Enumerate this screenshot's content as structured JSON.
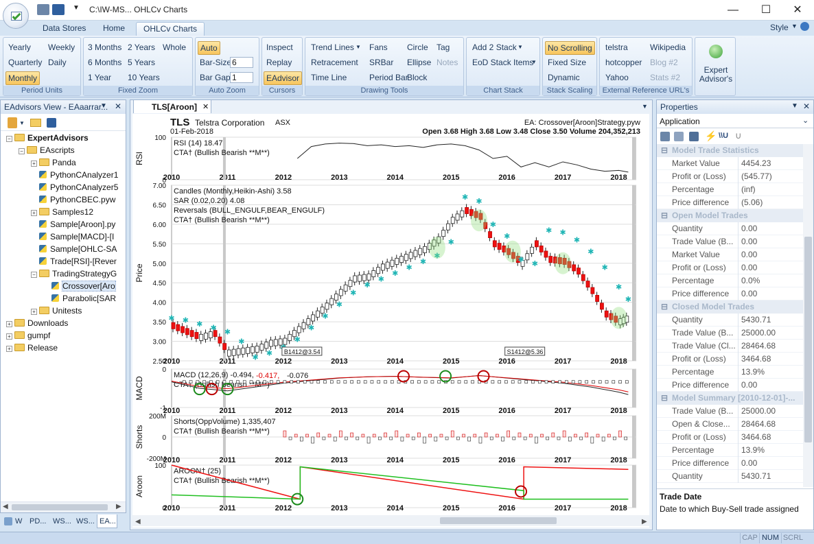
{
  "window": {
    "title": "C:\\IW-MS...     OHLCv Charts",
    "minimize": "—",
    "maximize": "☐",
    "close": "✕"
  },
  "tabs": [
    "Data Stores",
    "Home",
    "OHLCv Charts"
  ],
  "style_menu": "Style",
  "ribbon": {
    "period_units": {
      "label": "Period Units",
      "items": [
        "Yearly",
        "Weekly",
        "Quarterly",
        "Daily",
        "Monthly"
      ]
    },
    "fixed_zoom": {
      "label": "Fixed Zoom",
      "items": [
        "3 Months",
        "2 Years",
        "Whole",
        "6 Months",
        "5 Years",
        "1 Year",
        "10 Years"
      ]
    },
    "auto_zoom": {
      "label": "Auto Zoom",
      "auto": "Auto",
      "bar_size_label": "Bar-Size",
      "bar_size": "6",
      "bar_gap_label": "Bar Gap",
      "bar_gap": "1"
    },
    "cursors": {
      "label": "Cursors",
      "items": [
        "Inspect",
        "Replay",
        "EAdvisor"
      ]
    },
    "drawing_tools": {
      "label": "Drawing Tools",
      "items": [
        "Trend Lines",
        "Fans",
        "Circle",
        "Tag",
        "Retracement",
        "SRBar",
        "Ellipse",
        "Notes",
        "Time Line",
        "Period Bar",
        "Block"
      ]
    },
    "chart_stack": {
      "label": "Chart Stack",
      "items": [
        "Add 2 Stack",
        "EoD Stack Items"
      ]
    },
    "stack_scaling": {
      "label": "Stack Scaling",
      "items": [
        "No Scrolling",
        "Fixed Size",
        "Dynamic"
      ]
    },
    "external_refs": {
      "label": "External Reference URL's",
      "items": [
        "telstra",
        "Wikipedia",
        "hotcopper",
        "Blog #2",
        "Yahoo",
        "Stats #2"
      ]
    },
    "expert_advisors": {
      "label": "Expert Advisor's"
    }
  },
  "left_panel": {
    "title": "EAdvisors View - EAaarrar...",
    "tree": [
      {
        "label": "ExpertAdvisors",
        "level": 0,
        "type": "folder",
        "bold": true,
        "expander": "−"
      },
      {
        "label": "EAscripts",
        "level": 1,
        "type": "folder",
        "expander": "−"
      },
      {
        "label": "Panda",
        "level": 2,
        "type": "folder",
        "expander": "+"
      },
      {
        "label": "PythonCAnalyzer1",
        "level": 2,
        "type": "py"
      },
      {
        "label": "PythonCAnalyzer5",
        "level": 2,
        "type": "py"
      },
      {
        "label": "PythonCBEC.pyw",
        "level": 2,
        "type": "py"
      },
      {
        "label": "Samples12",
        "level": 2,
        "type": "folder",
        "expander": "+"
      },
      {
        "label": "Sample[Aroon].py",
        "level": 2,
        "type": "py"
      },
      {
        "label": "Sample[MACD]-[I",
        "level": 2,
        "type": "py"
      },
      {
        "label": "Sample[OHLC-SA",
        "level": 2,
        "type": "py"
      },
      {
        "label": "Trade[RSI]-[Rever",
        "level": 2,
        "type": "py"
      },
      {
        "label": "TradingStrategyG",
        "level": 2,
        "type": "folder",
        "expander": "−"
      },
      {
        "label": "Crossover[Aro",
        "level": 3,
        "type": "py",
        "selected": true
      },
      {
        "label": "Parabolic[SAR",
        "level": 3,
        "type": "py"
      },
      {
        "label": "Unitests",
        "level": 2,
        "type": "folder",
        "expander": "+"
      },
      {
        "label": "Downloads",
        "level": 0,
        "type": "folder",
        "expander": "+"
      },
      {
        "label": "gumpf",
        "level": 0,
        "type": "folder",
        "expander": "+"
      },
      {
        "label": "Release",
        "level": 0,
        "type": "folder",
        "expander": "+"
      }
    ],
    "bottom_tabs": [
      "W",
      "PD...",
      "WS...",
      "WS...",
      "EA..."
    ]
  },
  "document_tab": "TLS[Aroon]",
  "chart_header": {
    "ticker": "TLS",
    "company": "Telstra Corporation",
    "exchange": "ASX",
    "date": "01-Feb-2018",
    "ea": "EA: Crossover[Aroon]Strategy.pyw",
    "ohlcv": "Open 3.68  High 3.68  Low 3.48  Close 3.50  Volume 204,352,213"
  },
  "chart_data": [
    {
      "type": "line",
      "name": "RSI",
      "ylabel": "RSI",
      "legend": [
        "RSI (14)  18.47",
        "CTA† (Bullish Bearish  **M**)"
      ],
      "yticks": [
        "100",
        "0"
      ],
      "ylim": [
        0,
        100
      ],
      "x": [
        2010.0,
        2010.25,
        2010.5,
        2010.75,
        2011.0,
        2011.25,
        2011.5,
        2011.75,
        2012.0,
        2012.25,
        2012.5,
        2012.75,
        2013.0,
        2013.25,
        2013.5,
        2013.75,
        2014.0,
        2014.25,
        2014.5,
        2014.75,
        2015.0,
        2015.25,
        2015.5,
        2015.75,
        2016.0,
        2016.25,
        2016.5,
        2016.75,
        2017.0,
        2017.25,
        2017.5,
        2017.75,
        2018.0,
        2018.17
      ],
      "values": [
        null,
        null,
        null,
        null,
        null,
        null,
        null,
        null,
        null,
        50,
        78,
        84,
        86,
        85,
        80,
        82,
        78,
        80,
        76,
        82,
        84,
        80,
        70,
        50,
        55,
        30,
        40,
        30,
        42,
        35,
        25,
        20,
        22,
        18
      ]
    },
    {
      "type": "candlestick",
      "name": "Price",
      "ylabel": "Price",
      "legend": [
        "Candles (Monthly,Heikin-Ashi)  3.58",
        "SAR (0.02,0.20)  4.08",
        "Reversals (BULL_ENGULF,BEAR_ENGULF)",
        "CTA† (Bullish Bearish  **M**)"
      ],
      "yticks": [
        "7.00",
        "6.50",
        "6.00",
        "5.50",
        "5.00",
        "4.50",
        "4.00",
        "3.50",
        "3.00",
        "2.50"
      ],
      "ylim": [
        2.5,
        7.0
      ],
      "annotations": [
        "B1412@3.54",
        "S1412@5.36"
      ],
      "x": [
        2010.0,
        2010.25,
        2010.5,
        2010.75,
        2011.0,
        2011.25,
        2011.5,
        2011.75,
        2012.0,
        2012.25,
        2012.5,
        2012.75,
        2013.0,
        2013.25,
        2013.5,
        2013.75,
        2014.0,
        2014.25,
        2014.5,
        2014.75,
        2015.0,
        2015.25,
        2015.5,
        2015.75,
        2016.0,
        2016.25,
        2016.5,
        2016.75,
        2017.0,
        2017.25,
        2017.5,
        2017.75,
        2018.0,
        2018.17
      ],
      "values": [
        3.4,
        3.25,
        3.1,
        3.2,
        2.7,
        2.75,
        2.8,
        2.95,
        3.0,
        3.3,
        3.6,
        3.9,
        4.25,
        4.6,
        4.65,
        4.9,
        5.05,
        5.2,
        5.35,
        5.6,
        6.1,
        6.35,
        6.2,
        5.5,
        5.3,
        5.0,
        5.5,
        5.1,
        5.05,
        4.8,
        4.3,
        3.7,
        3.5,
        3.6
      ],
      "sar": [
        3.6,
        3.55,
        3.45,
        3.35,
        3.25,
        3.0,
        2.6,
        2.7,
        2.85,
        3.05,
        3.35,
        3.65,
        3.95,
        4.25,
        4.45,
        4.6,
        4.75,
        4.9,
        5.05,
        5.2,
        5.55,
        6.7,
        6.6,
        6.0,
        5.7,
        5.1,
        5.0,
        5.85,
        5.8,
        5.6,
        5.3,
        4.9,
        4.4,
        4.08
      ]
    },
    {
      "type": "line",
      "name": "MACD",
      "ylabel": "MACD",
      "legend": [
        "MACD (12,26,9)  -0.494,",
        "-0.417,",
        "-0.076",
        "CTA† (Bullish Bearish  **M**)"
      ],
      "yticks": [
        "0",
        "-1"
      ],
      "ylim": [
        -1,
        0.5
      ],
      "x": [
        2010.0,
        2010.5,
        2011.0,
        2011.5,
        2012.0,
        2012.5,
        2013.0,
        2013.5,
        2014.0,
        2014.5,
        2015.0,
        2015.5,
        2016.0,
        2016.5,
        2017.0,
        2017.5,
        2018.0,
        2018.17
      ],
      "values": [
        0.0,
        -0.25,
        -0.35,
        -0.2,
        -0.05,
        0.05,
        0.15,
        0.2,
        0.22,
        0.18,
        0.15,
        0.25,
        0.15,
        0.05,
        -0.05,
        -0.2,
        -0.4,
        -0.494
      ]
    },
    {
      "type": "bar",
      "name": "Shorts",
      "ylabel": "Shorts",
      "legend": [
        "Shorts(OppVolume)  1,335,407",
        "CTA† (Bullish Bearish  **M**)"
      ],
      "yticks": [
        "200M",
        "0",
        "-200M"
      ],
      "ylim": [
        -200,
        200
      ]
    },
    {
      "type": "line",
      "name": "Aroon",
      "ylabel": "Aroon",
      "legend": [
        "AROON† (25)",
        "CTA† (Bullish Bearish  **M**)"
      ],
      "yticks": [
        "100",
        "0"
      ],
      "ylim": [
        0,
        100
      ],
      "x": [
        2010.0,
        2012.3,
        2012.3,
        2016.3,
        2016.3,
        2018.17
      ],
      "series": [
        {
          "name": "up",
          "values": [
            100,
            20,
            96,
            20,
            96,
            90
          ]
        },
        {
          "name": "down",
          "values": [
            30,
            20,
            96,
            40,
            20,
            20
          ]
        }
      ]
    }
  ],
  "x_axis_years": [
    "2010",
    "2011",
    "2012",
    "2013",
    "2014",
    "2015",
    "2016",
    "2017",
    "2018"
  ],
  "right_panel": {
    "title": "Properties",
    "object": "Application",
    "sections": [
      {
        "title": "Model Trade Statistics",
        "rows": [
          [
            "Market Value",
            "4454.23"
          ],
          [
            "Profit or (Loss)",
            "(545.77)"
          ],
          [
            "Percentage",
            "(inf)"
          ],
          [
            "Price difference",
            "(5.06)"
          ]
        ]
      },
      {
        "title": "Open Model Trades",
        "rows": [
          [
            "Quantity",
            "0.00"
          ],
          [
            "Trade Value (B...",
            "0.00"
          ],
          [
            "Market Value",
            "0.00"
          ],
          [
            "Profit or (Loss)",
            "0.00"
          ],
          [
            "Percentage",
            "0.0%"
          ],
          [
            "Price difference",
            "0.00"
          ]
        ]
      },
      {
        "title": "Closed Model Trades",
        "rows": [
          [
            "Quantity",
            "5430.71"
          ],
          [
            "Trade Value (B...",
            "25000.00"
          ],
          [
            "Trade Value (Cl...",
            "28464.68"
          ],
          [
            "Profit or (Loss)",
            "3464.68"
          ],
          [
            "Percentage",
            "13.9%"
          ],
          [
            "Price difference",
            "0.00"
          ]
        ]
      },
      {
        "title": "Model Summary [2010-12-01]-...",
        "rows": [
          [
            "Trade Value (B...",
            "25000.00"
          ],
          [
            "Open & Close...",
            "28464.68"
          ],
          [
            "Profit or (Loss)",
            "3464.68"
          ],
          [
            "Percentage",
            "13.9%"
          ],
          [
            "Price difference",
            "0.00"
          ],
          [
            "Quantity",
            "5430.71"
          ]
        ]
      }
    ],
    "desc_title": "Trade Date",
    "desc_text": "Date to which Buy-Sell trade assigned"
  },
  "status": [
    "CAP",
    "NUM",
    "SCRL"
  ]
}
